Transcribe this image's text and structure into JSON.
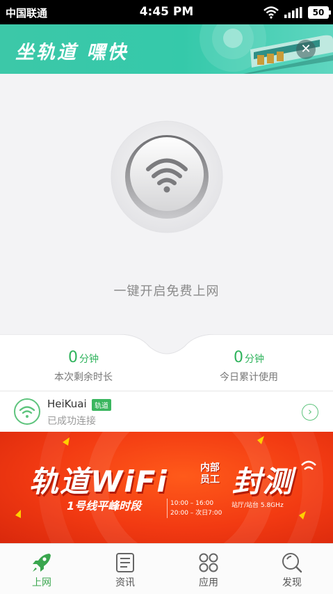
{
  "status_bar": {
    "carrier": "中国联通",
    "time": "4:45 PM",
    "battery": "50"
  },
  "banner": {
    "title": "坐轨道 嘿快",
    "close_icon": "close-icon"
  },
  "main": {
    "start_label": "一键开启免费上网"
  },
  "stats": {
    "remaining": {
      "value": "0",
      "unit": "分钟",
      "label": "本次剩余时长"
    },
    "today": {
      "value": "0",
      "unit": "分钟",
      "label": "今日累计使用"
    }
  },
  "connection": {
    "ssid": "HeiKuai",
    "badge": "轨道",
    "status": "已成功连接"
  },
  "promo": {
    "headline": "轨道WiFi",
    "tag_line1": "内部",
    "tag_line2": "员工",
    "test": "封测",
    "subtitle": "1号线平峰时段",
    "time1": "10:00 – 16:00",
    "time2": "20:00 – 次日7:00",
    "station": "站厅/站台 5.8GHz"
  },
  "tabs": [
    {
      "label": "上网",
      "icon": "rocket-icon",
      "active": true
    },
    {
      "label": "资讯",
      "icon": "news-icon",
      "active": false
    },
    {
      "label": "应用",
      "icon": "apps-icon",
      "active": false
    },
    {
      "label": "发现",
      "icon": "discover-icon",
      "active": false
    }
  ],
  "colors": {
    "accent_green": "#2fb35c",
    "banner_teal": "#3cc8a8",
    "promo_red": "#f23a12"
  }
}
